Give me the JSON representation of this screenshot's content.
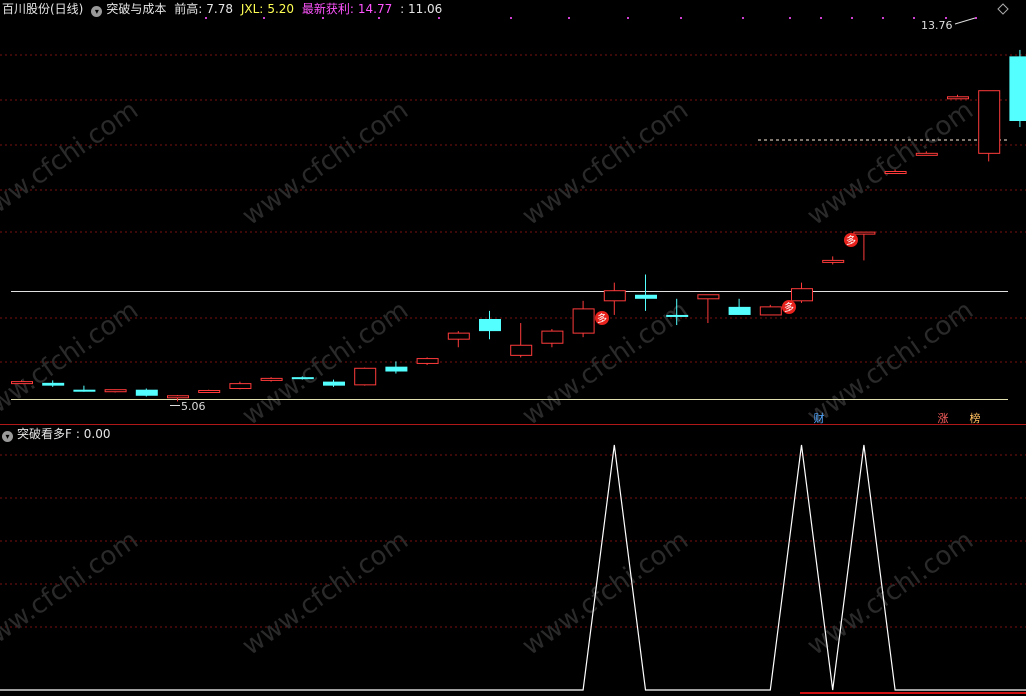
{
  "header": {
    "stock": "百川股份(日线)",
    "indicator": "突破与成本",
    "prev_high_label": "前高:",
    "prev_high_value": "7.78",
    "jxl_label": "JXL:",
    "jxl_value": "5.20",
    "latest_profit_label": "最新获利:",
    "latest_profit_value": "14.77",
    "extra_value": ": 11.06"
  },
  "indicator_header": {
    "name": "突破看多F",
    "value": ": 0.00"
  },
  "watermark": "www.cfchi.com",
  "colors": {
    "up": "#ff3b3b",
    "down": "#54ffff",
    "grid": "#7a1010",
    "level_line": "#e0e0e0",
    "low_line": "#e0e0b0",
    "indicator_line": "#ffffff",
    "marker_bg": "#e8231e"
  },
  "chart_data": [
    {
      "type": "candlestick",
      "title": "突破与成本",
      "levels": [
        {
          "name": "前高",
          "value": 7.78
        },
        {
          "name": "JXL",
          "value": 5.2
        }
      ],
      "ylim": [
        4.6,
        14.5
      ],
      "annotations": {
        "low_label": "5.06",
        "high_label": "13.76",
        "markers": [
          "多",
          "多",
          "多"
        ],
        "badges": [
          "财",
          "涨",
          "榜"
        ]
      },
      "candles": [
        {
          "o": 5.55,
          "h": 5.58,
          "l": 5.5,
          "c": 5.55
        },
        {
          "o": 5.52,
          "h": 5.58,
          "l": 5.42,
          "c": 5.45
        },
        {
          "o": 5.35,
          "h": 5.45,
          "l": 5.3,
          "c": 5.3
        },
        {
          "o": 5.3,
          "h": 5.36,
          "l": 5.28,
          "c": 5.35
        },
        {
          "o": 5.35,
          "h": 5.38,
          "l": 5.18,
          "c": 5.2
        },
        {
          "o": 5.15,
          "h": 5.22,
          "l": 5.06,
          "c": 5.2
        },
        {
          "o": 5.3,
          "h": 5.35,
          "l": 5.28,
          "c": 5.33
        },
        {
          "o": 5.38,
          "h": 5.55,
          "l": 5.36,
          "c": 5.5
        },
        {
          "o": 5.58,
          "h": 5.66,
          "l": 5.55,
          "c": 5.63
        },
        {
          "o": 5.66,
          "h": 5.68,
          "l": 5.6,
          "c": 5.62
        },
        {
          "o": 5.55,
          "h": 5.6,
          "l": 5.42,
          "c": 5.45
        },
        {
          "o": 5.47,
          "h": 5.9,
          "l": 5.45,
          "c": 5.88
        },
        {
          "o": 5.92,
          "h": 6.05,
          "l": 5.75,
          "c": 5.8
        },
        {
          "o": 6.0,
          "h": 6.15,
          "l": 5.96,
          "c": 6.12
        },
        {
          "o": 6.6,
          "h": 6.8,
          "l": 6.4,
          "c": 6.75
        },
        {
          "o": 7.1,
          "h": 7.3,
          "l": 6.6,
          "c": 6.8
        },
        {
          "o": 6.2,
          "h": 7.0,
          "l": 6.15,
          "c": 6.45
        },
        {
          "o": 6.5,
          "h": 6.85,
          "l": 6.4,
          "c": 6.8
        },
        {
          "o": 6.75,
          "h": 7.55,
          "l": 6.65,
          "c": 7.35
        },
        {
          "o": 7.55,
          "h": 8.0,
          "l": 7.2,
          "c": 7.8
        },
        {
          "o": 7.7,
          "h": 8.2,
          "l": 7.3,
          "c": 7.6
        },
        {
          "o": 7.2,
          "h": 7.6,
          "l": 6.95,
          "c": 7.17
        },
        {
          "o": 7.6,
          "h": 7.7,
          "l": 7.0,
          "c": 7.7
        },
        {
          "o": 7.4,
          "h": 7.6,
          "l": 7.3,
          "c": 7.2
        },
        {
          "o": 7.2,
          "h": 7.45,
          "l": 7.2,
          "c": 7.4
        },
        {
          "o": 7.55,
          "h": 8.0,
          "l": 7.5,
          "c": 7.85
        },
        {
          "o": 8.55,
          "h": 8.65,
          "l": 8.45,
          "c": 8.55
        },
        {
          "o": 9.25,
          "h": 9.25,
          "l": 8.55,
          "c": 9.25
        },
        {
          "o": 10.75,
          "h": 10.8,
          "l": 10.7,
          "c": 10.75
        },
        {
          "o": 11.2,
          "h": 11.25,
          "l": 11.15,
          "c": 11.2
        },
        {
          "o": 12.6,
          "h": 12.65,
          "l": 12.55,
          "c": 12.6
        },
        {
          "o": 11.2,
          "h": 12.6,
          "l": 11.0,
          "c": 12.75
        },
        {
          "o": 13.6,
          "h": 13.76,
          "l": 11.85,
          "c": 12.0
        },
        {
          "o": 13.15,
          "h": 13.25,
          "l": 11.8,
          "c": 12.25
        }
      ]
    },
    {
      "type": "line",
      "title": "突破看多F",
      "ylim": [
        0,
        1
      ],
      "values": [
        0,
        0,
        0,
        0,
        0,
        0,
        0,
        0,
        0,
        0,
        0,
        0,
        0,
        0,
        0,
        0,
        0,
        0,
        0,
        1,
        0,
        0,
        0,
        0,
        0,
        1,
        0,
        1,
        0,
        0,
        0,
        0,
        0,
        0
      ]
    }
  ]
}
